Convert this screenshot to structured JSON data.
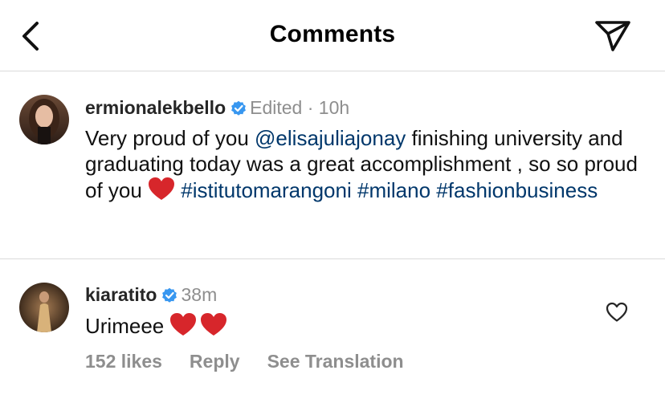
{
  "header": {
    "title": "Comments",
    "back_icon": "chevron-left-icon",
    "send_icon": "paper-plane-icon"
  },
  "post": {
    "username": "ermionalekbello",
    "verified": true,
    "edited_label": "Edited",
    "separator": "·",
    "time": "10h",
    "text_start": "Very proud of you ",
    "mention": "@elisajuliajonay",
    "text_middle": " finishing university and graduating today was a great accomplishment , so so proud of you ",
    "heart_emoji": "❤️",
    "hashtags": [
      "#istitutomarangoni",
      "#milano",
      "#fashionbusiness"
    ]
  },
  "comment": {
    "username": "kiaratito",
    "verified": true,
    "time": "38m",
    "text": "Urimeee",
    "emojis": "❤️❤️",
    "likes": "152 likes",
    "reply_label": "Reply",
    "translate_label": "See Translation",
    "like_icon": "heart-outline-icon"
  },
  "colors": {
    "link": "#00376b",
    "verified": "#3897f0",
    "muted": "#8e8e8e",
    "divider": "#dbdbdb",
    "heart": "#d7262b"
  }
}
